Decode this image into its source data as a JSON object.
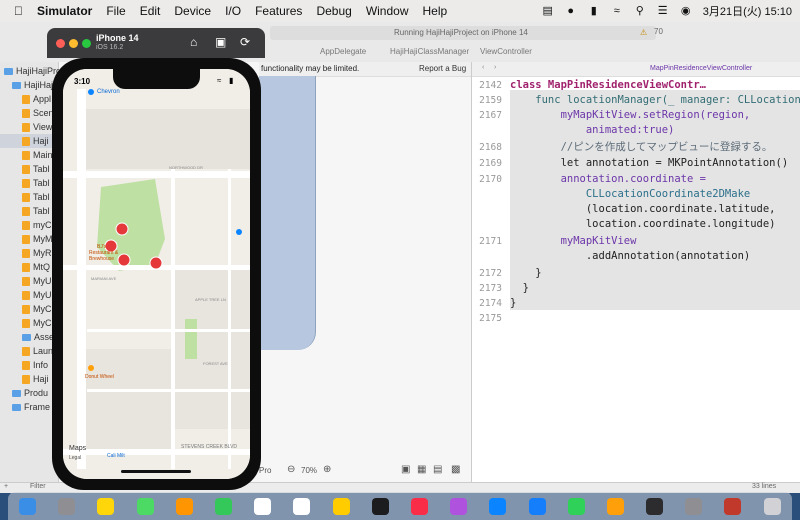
{
  "menubar": {
    "app": "Simulator",
    "items": [
      "File",
      "Edit",
      "Device",
      "I/O",
      "Features",
      "Debug",
      "Window",
      "Help"
    ],
    "clock": "3月21日(火) 15:10"
  },
  "xcode": {
    "tabs": [
      "AppDelegate",
      "HajiHajiClassManager",
      "ViewController"
    ],
    "run_status": "Running HajiHajiProject on iPhone 14",
    "warning_count": "70",
    "canvas_notice": "functionality may be limited.",
    "report_bug": "Report a Bug",
    "sidebar_items": [
      "HajiHajiProje",
      "HajiHajiP",
      "Appl",
      "Scen",
      "View",
      "Haji",
      "Main",
      "Tabl",
      "Tabl",
      "Tabl",
      "Tabl",
      "myC",
      "MyM",
      "MyR",
      "MtQ",
      "MyU",
      "MyU",
      "MyC",
      "MyC",
      "Asse",
      "Laun",
      "Info",
      "Haji",
      "Produ",
      "Frame"
    ],
    "filter_placeholder": "Filter",
    "zoom": "70%",
    "canvas_label": "Pro",
    "line_count": "33 lines",
    "breadcrumb": "MapPinResidenceViewController",
    "code": {
      "l2142_num": "2142",
      "l2142": "class MapPinResidenceViewContr…",
      "l2159_num": "2159",
      "l2159": "    func locationManager(_ manager: CLLocationMa…",
      "l2167_num": "2167",
      "l2167a": "        myMapKitView.setRegion(region,",
      "l2167b": "            animated:true)",
      "l2168_num": "2168",
      "l2168": "        //ピンを作成してマップビューに登録する。",
      "l2169_num": "2169",
      "l2169": "        let annotation = MKPointAnnotation()",
      "l2170_num": "2170",
      "l2170a": "        annotation.coordinate =",
      "l2170b": "            CLLocationCoordinate2DMake",
      "l2170c": "            (location.coordinate.latitude,",
      "l2170d": "            location.coordinate.longitude)",
      "l2171_num": "2171",
      "l2171a": "        myMapKitView",
      "l2171b": "            .addAnnotation(annotation)",
      "l2172_num": "2172",
      "l2172": "    }",
      "l2173_num": "2173",
      "l2173": "  }",
      "l2174_num": "2174",
      "l2174": "}",
      "l2175_num": "2175"
    }
  },
  "simulator": {
    "device": "iPhone 14",
    "os": "iOS 16.2"
  },
  "phone": {
    "time": "3:10",
    "map_labels": {
      "chevron": "Chevron",
      "northwood": "NORTHWOOD DR",
      "restaurant": "Restaurant & Brewhouse",
      "bjs": "BJ's",
      "mariani": "MARIANI AVE",
      "apple_tree": "APPLE TREE LN",
      "forest": "FOREST AVE",
      "donut": "Donut Wheel",
      "stevens": "STEVENS CREEK BLVD",
      "maps_logo": "Maps",
      "legal": "Legal",
      "calmilt": "Cali Milt"
    }
  },
  "colors": {
    "accent": "#0a84ff",
    "pin": "#e5383b",
    "park": "#bfe0a3"
  }
}
